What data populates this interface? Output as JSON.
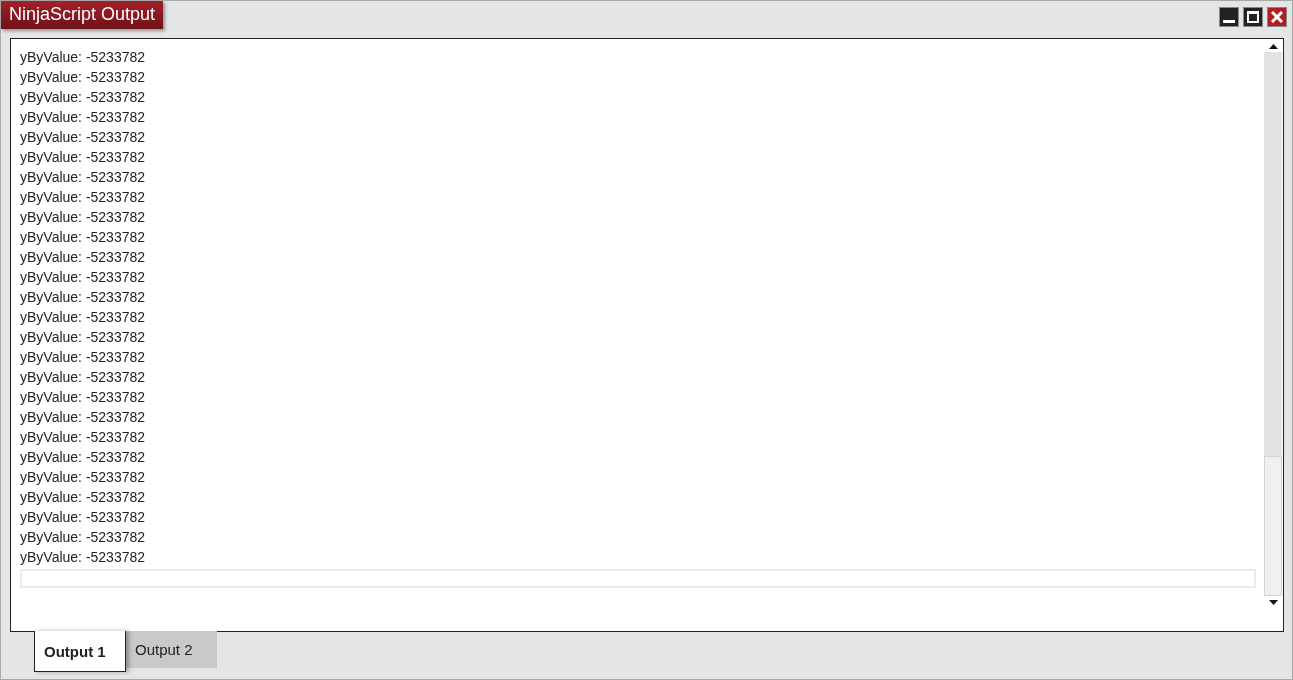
{
  "window": {
    "title": "NinjaScript Output"
  },
  "output_lines": [
    "yByValue: -5233782",
    "yByValue: -5233782",
    "yByValue: -5233782",
    "yByValue: -5233782",
    "yByValue: -5233782",
    "yByValue: -5233782",
    "yByValue: -5233782",
    "yByValue: -5233782",
    "yByValue: -5233782",
    "yByValue: -5233782",
    "yByValue: -5233782",
    "yByValue: -5233782",
    "yByValue: -5233782",
    "yByValue: -5233782",
    "yByValue: -5233782",
    "yByValue: -5233782",
    "yByValue: -5233782",
    "yByValue: -5233782",
    "yByValue: -5233782",
    "yByValue: -5233782",
    "yByValue: -5233782",
    "yByValue: -5233782",
    "yByValue: -5233782",
    "yByValue: -5233782",
    "yByValue: -5233782",
    "yByValue: -5233782"
  ],
  "tabs": [
    {
      "label": "Output 1",
      "selected": true
    },
    {
      "label": "Output 2",
      "selected": false
    }
  ]
}
